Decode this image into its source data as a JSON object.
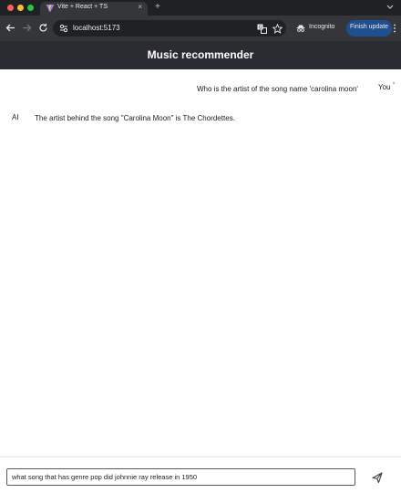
{
  "browser": {
    "tab_title": "Vite + React + TS",
    "tab_close": "×",
    "new_tab": "+",
    "url": "localhost:5173",
    "incognito_label": "Incognito",
    "finish_update_label": "Finish update"
  },
  "app": {
    "title": "Music recommender"
  },
  "chat": {
    "messages": [
      {
        "sender": "You",
        "text": "Who is the artist of the song name 'carolina moon'"
      },
      {
        "sender": "AI",
        "text": "The artist behind the song \"Carolina Moon\" is The Chordettes."
      }
    ]
  },
  "composer": {
    "value": "what song that has genre pop did johnnie ray release in 1950"
  },
  "colors": {
    "header_bg": "#2b2c31",
    "browser_chrome": "#35363a",
    "finish_update_bg": "#1f4f8f"
  }
}
